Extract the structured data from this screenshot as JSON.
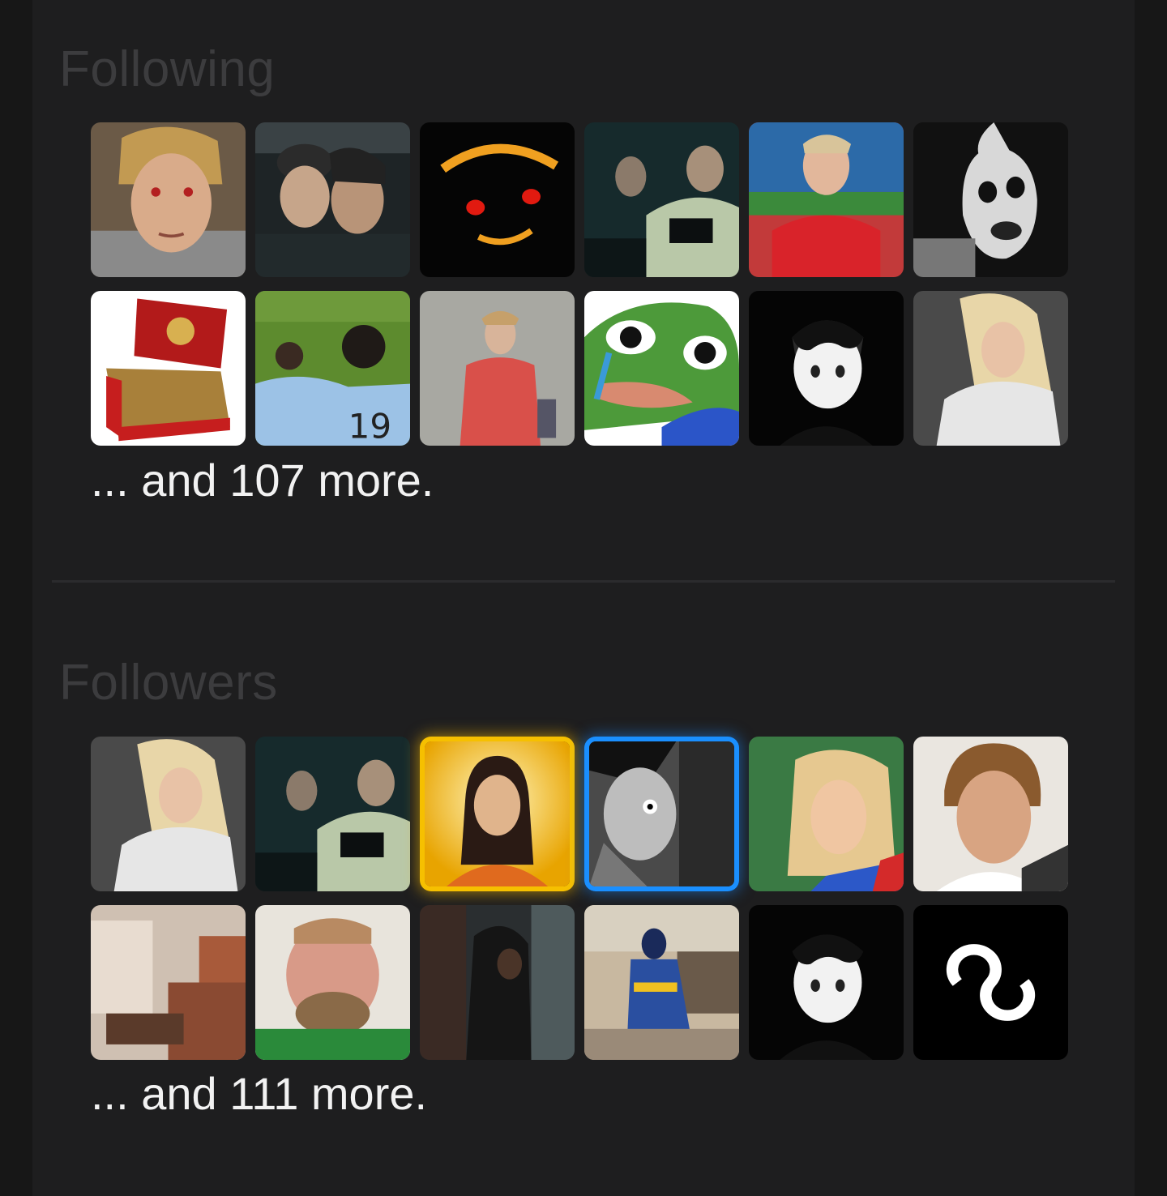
{
  "following": {
    "title": "Following",
    "more_text": "... and 107 more.",
    "avatars": [
      {
        "name": "avatar-blond-man-red-eyes"
      },
      {
        "name": "avatar-two-friends-beanie"
      },
      {
        "name": "avatar-dark-grinning-face"
      },
      {
        "name": "avatar-car-driver-jacket"
      },
      {
        "name": "avatar-footballer-red-shirt"
      },
      {
        "name": "avatar-horror-clown"
      },
      {
        "name": "avatar-cigar-box"
      },
      {
        "name": "avatar-football-players-celebrating"
      },
      {
        "name": "avatar-man-orange-jumpsuit"
      },
      {
        "name": "avatar-crying-frog-meme"
      },
      {
        "name": "avatar-monochrome-boy"
      },
      {
        "name": "avatar-blonde-woman"
      }
    ]
  },
  "followers": {
    "title": "Followers",
    "more_text": "... and 111 more.",
    "avatars": [
      {
        "name": "avatar-blonde-woman"
      },
      {
        "name": "avatar-car-driver-jacket"
      },
      {
        "name": "avatar-monk-golden-halo",
        "frame": "gold"
      },
      {
        "name": "avatar-manga-character",
        "frame": "blue"
      },
      {
        "name": "avatar-woman-leaves"
      },
      {
        "name": "avatar-man-brown-hair"
      },
      {
        "name": "avatar-blurred-room"
      },
      {
        "name": "avatar-man-covering-mouth"
      },
      {
        "name": "avatar-hooded-figure"
      },
      {
        "name": "avatar-racing-driver"
      },
      {
        "name": "avatar-monochrome-boy"
      },
      {
        "name": "avatar-infinity-logo"
      }
    ]
  },
  "colors": {
    "background": "#1e1e1f",
    "title": "#3c3c3e",
    "text": "#f2f2f2",
    "gold_frame": "#f6c000",
    "blue_frame": "#1a8fff"
  }
}
